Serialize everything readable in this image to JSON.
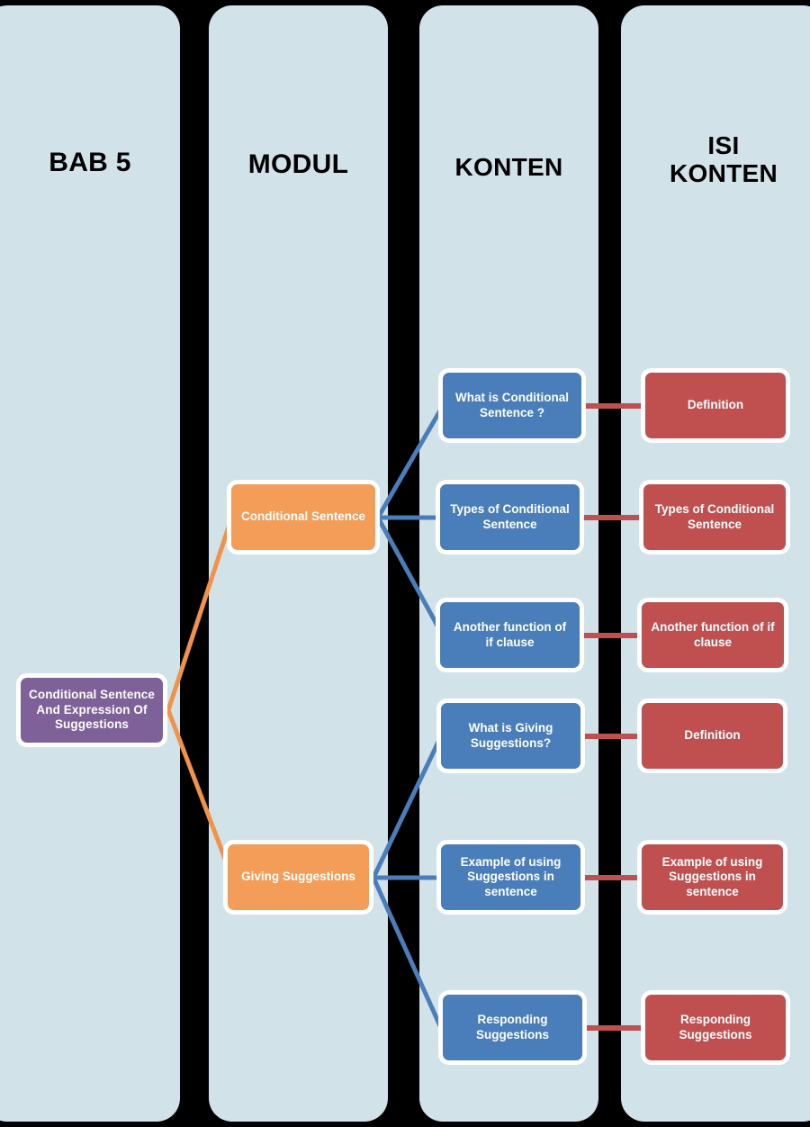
{
  "columns": [
    {
      "id": "bab5",
      "title": "BAB 5"
    },
    {
      "id": "modul",
      "title": "MODUL"
    },
    {
      "id": "konten",
      "title": "KONTEN"
    },
    {
      "id": "isi",
      "title": "ISI\nKONTEN"
    }
  ],
  "column_titles": {
    "bab5": "BAB 5",
    "modul": "MODUL",
    "konten": "KONTEN",
    "isi_line1": "ISI",
    "isi_line2": "KONTEN"
  },
  "root": {
    "label": "Conditional Sentence And Expression Of Suggestions",
    "color": "#7e6198"
  },
  "modules": [
    {
      "label": "Conditional Sentence",
      "color": "#f39d58"
    },
    {
      "label": "Giving Suggestions",
      "color": "#f39d58"
    }
  ],
  "contents": [
    {
      "label": "What is Conditional Sentence ?",
      "color": "#4a7ebb"
    },
    {
      "label": "Types of Conditional Sentence",
      "color": "#4a7ebb"
    },
    {
      "label": "Another function of if clause",
      "color": "#4a7ebb"
    },
    {
      "label": "What is Giving Suggestions?",
      "color": "#4a7ebb"
    },
    {
      "label": "Example of using Suggestions in sentence",
      "color": "#4a7ebb"
    },
    {
      "label": "Responding Suggestions",
      "color": "#4a7ebb"
    }
  ],
  "details": [
    {
      "label": "Definition",
      "color": "#c04f4f"
    },
    {
      "label": "Types of Conditional Sentence",
      "color": "#c04f4f"
    },
    {
      "label": "Another function of if clause",
      "color": "#c04f4f"
    },
    {
      "label": "Definition",
      "color": "#c04f4f"
    },
    {
      "label": "Example of using Suggestions in sentence",
      "color": "#c04f4f"
    },
    {
      "label": "Responding Suggestions",
      "color": "#c04f4f"
    }
  ],
  "palette": {
    "background": "#000000",
    "panel": "#d2e2e9",
    "root": "#7e6198",
    "module": "#f39d58",
    "content": "#4a7ebb",
    "detail": "#c04f4f",
    "node_border": "#ffffff",
    "link_root_module": "#f0924a",
    "link_module_content": "#4a7ebb",
    "link_content_detail": "#c04f4f",
    "title_text": "#000000",
    "node_text": "#ffffff"
  }
}
